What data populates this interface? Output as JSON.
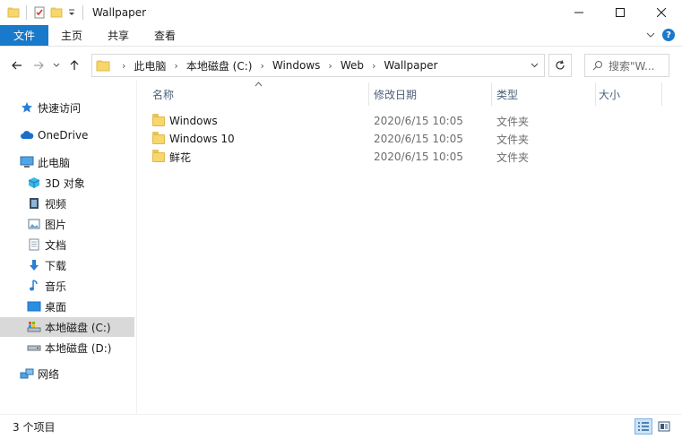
{
  "window": {
    "title": "Wallpaper",
    "controls": [
      "minimize",
      "maximize",
      "close"
    ]
  },
  "ribbon": {
    "tabs": [
      "文件",
      "主页",
      "共享",
      "查看"
    ],
    "help": "?"
  },
  "address": {
    "crumbs": [
      "此电脑",
      "本地磁盘 (C:)",
      "Windows",
      "Web",
      "Wallpaper"
    ],
    "search_placeholder": "搜索\"W..."
  },
  "nav": {
    "quick_access": "快速访问",
    "onedrive": "OneDrive",
    "this_pc": "此电脑",
    "items": [
      "3D 对象",
      "视频",
      "图片",
      "文档",
      "下载",
      "音乐",
      "桌面",
      "本地磁盘 (C:)",
      "本地磁盘 (D:)"
    ],
    "network": "网络"
  },
  "columns": {
    "name": "名称",
    "date": "修改日期",
    "type": "类型",
    "size": "大小"
  },
  "files": [
    {
      "name": "Windows",
      "date": "2020/6/15 10:05",
      "type": "文件夹"
    },
    {
      "name": "Windows 10",
      "date": "2020/6/15 10:05",
      "type": "文件夹"
    },
    {
      "name": "鲜花",
      "date": "2020/6/15 10:05",
      "type": "文件夹"
    }
  ],
  "status": {
    "count": "3 个项目"
  },
  "colors": {
    "accent": "#1979ca",
    "folder": "#f7d66c",
    "selection": "#d9d9d9"
  }
}
